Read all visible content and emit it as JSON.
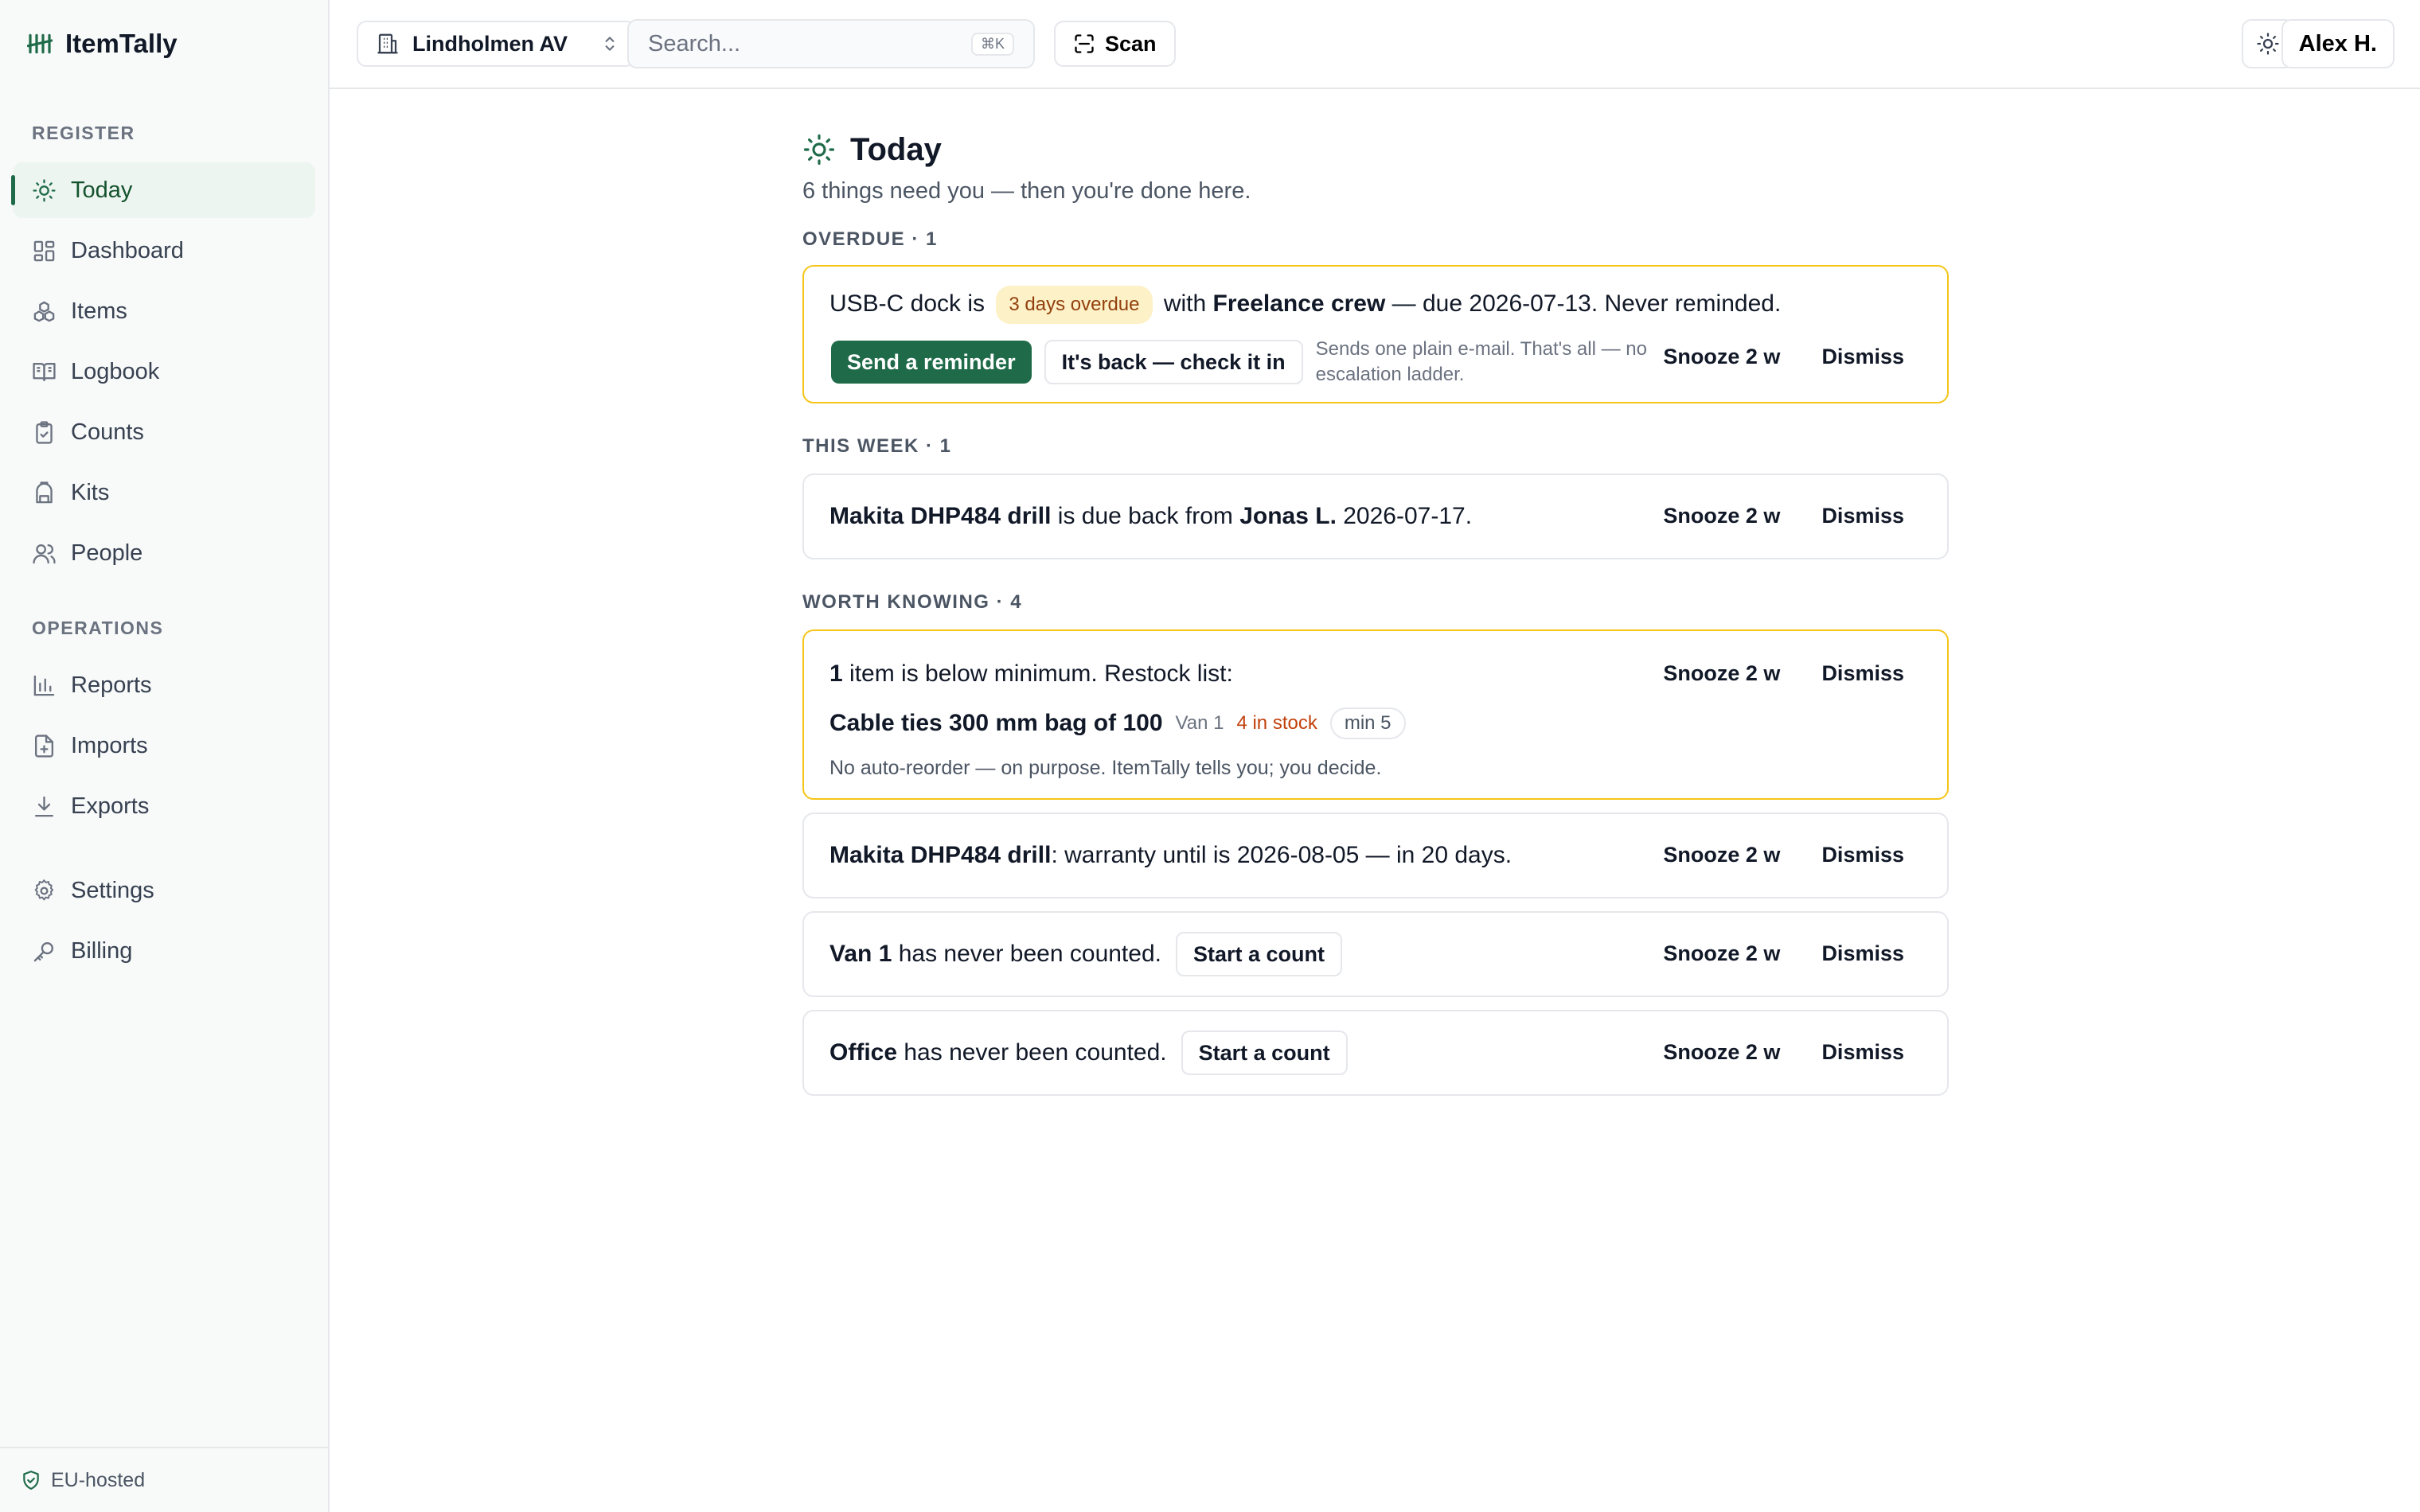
{
  "app": {
    "brand": "ItemTally",
    "footer": "EU-hosted"
  },
  "sidebar": {
    "register_label": "REGISTER",
    "operations_label": "OPERATIONS",
    "register_items": [
      {
        "label": "Today",
        "icon": "sun-icon",
        "active": true
      },
      {
        "label": "Dashboard",
        "icon": "dashboard-icon"
      },
      {
        "label": "Items",
        "icon": "boxes-icon"
      },
      {
        "label": "Logbook",
        "icon": "book-icon"
      },
      {
        "label": "Counts",
        "icon": "clipboard-icon"
      },
      {
        "label": "Kits",
        "icon": "backpack-icon"
      },
      {
        "label": "People",
        "icon": "users-icon"
      }
    ],
    "operations_items": [
      {
        "label": "Reports",
        "icon": "bar-chart-icon"
      },
      {
        "label": "Imports",
        "icon": "file-import-icon"
      },
      {
        "label": "Exports",
        "icon": "download-icon"
      }
    ],
    "extra_items": [
      {
        "label": "Settings",
        "icon": "gear-icon"
      },
      {
        "label": "Billing",
        "icon": "key-icon"
      }
    ]
  },
  "topbar": {
    "workspace": "Lindholmen AV",
    "search_placeholder": "Search...",
    "search_shortcut": "⌘K",
    "scan_label": "Scan",
    "user_label": "Alex H."
  },
  "page": {
    "title": "Today",
    "subtitle": "6 things need you — then you're done here."
  },
  "actions": {
    "snooze": "Snooze 2 w",
    "dismiss": "Dismiss"
  },
  "overdue": {
    "label": "OVERDUE · 1",
    "item": "USB-C dock",
    "is": " is ",
    "badge": "3 days overdue",
    "with": " with ",
    "who": "Freelance crew",
    "rest": " — due 2026-07-13. Never reminded.",
    "send_reminder": "Send a reminder",
    "check_in": "It's back — check it in",
    "hint": "Sends one plain e-mail. That's all — no escalation ladder."
  },
  "this_week": {
    "label": "THIS WEEK · 1",
    "item": "Makita DHP484 drill",
    "middle": " is due back from ",
    "who": "Jonas L.",
    "rest": " 2026-07-17."
  },
  "worth_knowing": {
    "label": "WORTH KNOWING · 4",
    "restock": {
      "count": "1",
      "text": " item is below minimum. Restock list:",
      "item": "Cable ties 300 mm bag of 100",
      "location": "Van 1",
      "stock": "4 in stock",
      "min": "min 5",
      "note": "No auto-reorder — on purpose. ItemTally tells you; you decide."
    },
    "warranty": {
      "item": "Makita DHP484 drill",
      "text": ": warranty until is 2026-08-05 — in 20 days."
    },
    "count_van": {
      "place": "Van 1",
      "text": " has never been counted.",
      "button": "Start a count"
    },
    "count_office": {
      "place": "Office",
      "text": " has never been counted.",
      "button": "Start a count"
    }
  }
}
